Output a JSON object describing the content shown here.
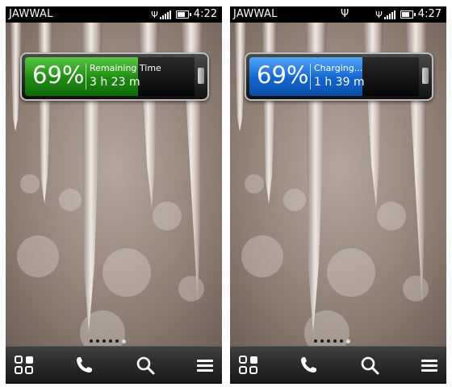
{
  "screens": [
    {
      "status": {
        "carrier": "JAWWAL",
        "time": "4:22"
      },
      "battery_widget": {
        "percent": "69%",
        "label": "Remaining Time",
        "time": "3 h 23 m",
        "fill_fraction": 0.69,
        "fill_color": "#2ea51c"
      },
      "page_dots": {
        "count": 6,
        "active_index": 5
      },
      "dock": [
        "apps-grid-icon",
        "phone-icon",
        "search-icon",
        "menu-icon"
      ]
    },
    {
      "status": {
        "carrier": "JAWWAL",
        "usb_icon": "usb-icon",
        "time": "4:27"
      },
      "battery_widget": {
        "percent": "69%",
        "label": "Charging...",
        "time": "1 h 39 m",
        "fill_fraction": 0.69,
        "fill_color": "#1c6fd8"
      },
      "page_dots": {
        "count": 6,
        "active_index": 5
      },
      "dock": [
        "apps-grid-icon",
        "phone-icon",
        "search-icon",
        "menu-icon"
      ]
    }
  ]
}
